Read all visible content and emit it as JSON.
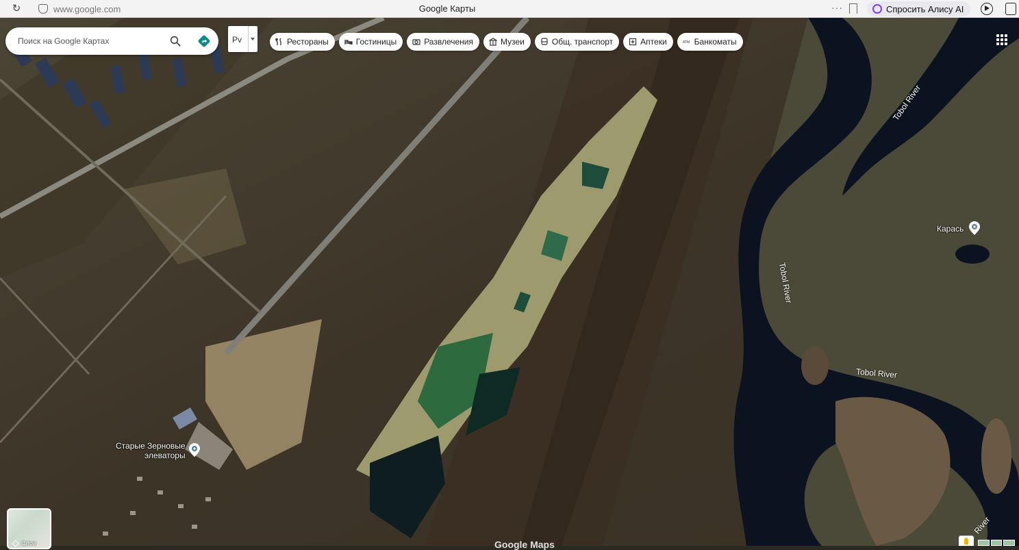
{
  "browser": {
    "url": "www.google.com",
    "tab_title": "Google Карты",
    "more_label": "···",
    "assistant_label": "Спросить Алису AI"
  },
  "search": {
    "placeholder": "Поиск на Google Картах"
  },
  "lang_button": {
    "label": "Рv"
  },
  "chips": [
    {
      "label": "Рестораны",
      "icon": "restaurant-icon"
    },
    {
      "label": "Гостиницы",
      "icon": "hotel-icon"
    },
    {
      "label": "Развлечения",
      "icon": "camera-icon"
    },
    {
      "label": "Музеи",
      "icon": "museum-icon"
    },
    {
      "label": "Общ. транспорт",
      "icon": "transit-icon"
    },
    {
      "label": "Аптеки",
      "icon": "pharmacy-icon"
    },
    {
      "label": "Банкоматы",
      "icon": "atm-icon"
    }
  ],
  "map": {
    "places": [
      {
        "name": "Старые Зерновые\nэлеваторы"
      },
      {
        "name": "Карась"
      }
    ],
    "river_labels": [
      "Tobol River",
      "Tobol River",
      "Tobol River",
      "River"
    ],
    "watermark": "Google Maps",
    "layers_label": "Слои"
  },
  "colors": {
    "accent": "#1a73e8",
    "directions": "#0b8a8a",
    "water": "#0c1320"
  }
}
